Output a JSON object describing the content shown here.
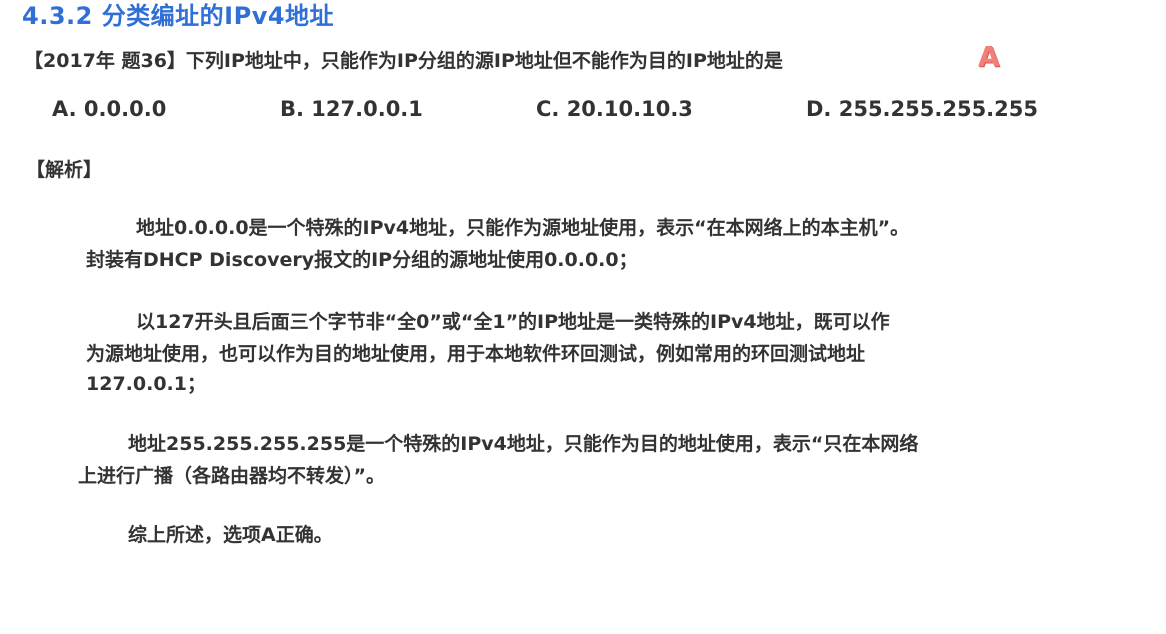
{
  "section_title": "4.3.2 分类编址的IPv4地址",
  "question": {
    "text": "【2017年 题36】下列IP地址中，只能作为IP分组的源IP地址但不能作为目的IP地址的是",
    "answer": "A",
    "answer_color": "#f08078"
  },
  "options": [
    "A. 0.0.0.0",
    "B. 127.0.0.1",
    "C. 20.10.10.3",
    "D. 255.255.255.255"
  ],
  "analysis": {
    "heading": "【解析】",
    "lines": [
      "地址0.0.0.0是一个特殊的IPv4地址，只能作为源地址使用，表示“在本网络上的本主机”。",
      "封装有DHCP Discovery报文的IP分组的源地址使用0.0.0.0；",
      "以127开头且后面三个字节非“全0”或“全1”的IP地址是一类特殊的IPv4地址，既可以作",
      "为源地址使用，也可以作为目的地址使用，用于本地软件环回测试，例如常用的环回测试地址",
      "127.0.0.1；",
      "地址255.255.255.255是一个特殊的IPv4地址，只能作为目的地址使用，表示“只在本网络",
      "上进行广播（各路由器均不转发）”。",
      "综上所述，选项A正确。"
    ]
  },
  "colors": {
    "title": "#2f6fd6",
    "text": "#333333"
  }
}
